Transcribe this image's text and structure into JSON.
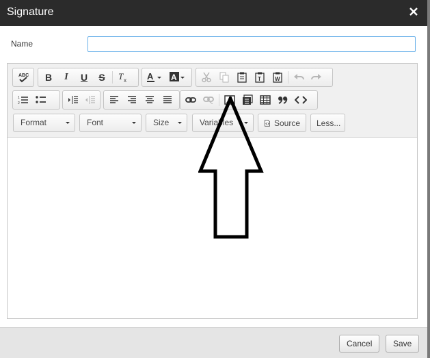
{
  "dialog": {
    "title": "Signature",
    "close_glyph": "✕"
  },
  "name_field": {
    "label": "Name",
    "value": ""
  },
  "toolbar": {
    "row1": {
      "spellcheck": "spellcheck-icon",
      "bold": "B",
      "italic": "I",
      "underline": "U",
      "strike": "S",
      "remove_format": "Tx",
      "text_color": "A",
      "bg_color": "A",
      "cut": "cut-icon",
      "copy": "copy-icon",
      "paste": "paste-icon",
      "paste_text": "paste-text-icon",
      "paste_word": "paste-word-icon",
      "undo": "undo-icon",
      "redo": "redo-icon"
    },
    "row2": {
      "numbered_list": "numbered-list-icon",
      "bulleted_list": "bulleted-list-icon",
      "indent": "indent-icon",
      "outdent": "outdent-icon",
      "align_left": "align-left-icon",
      "align_right": "align-right-icon",
      "align_center": "align-center-icon",
      "justify": "justify-icon",
      "link": "link-icon",
      "unlink": "unlink-icon",
      "image": "image-icon",
      "flash": "flash-icon",
      "table": "table-icon",
      "blockquote": "❞❞",
      "code": "<>"
    },
    "row3": {
      "format": "Format",
      "font": "Font",
      "size": "Size",
      "variables": "Variables",
      "source": "Source",
      "less": "Less..."
    }
  },
  "footer": {
    "cancel": "Cancel",
    "save": "Save"
  },
  "colors": {
    "titlebar": "#2b2b2b",
    "input_focus_border": "#66afe9",
    "toolbar_bg": "#f0f0f0",
    "footer_bg": "#e5e5e5"
  }
}
